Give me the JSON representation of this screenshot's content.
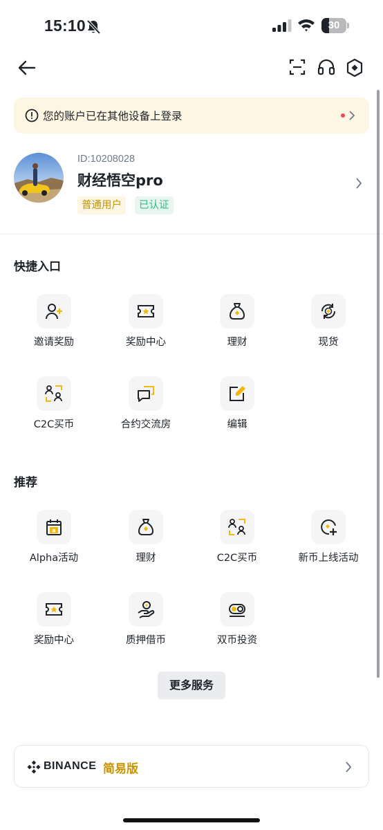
{
  "status_bar": {
    "time": "15:10",
    "battery_percent": 30,
    "icons": [
      "bell-slash-icon",
      "cellular-signal-icon",
      "wifi-icon",
      "battery-icon"
    ]
  },
  "nav": {
    "icons": [
      "back-arrow-icon",
      "scan-icon",
      "headset-icon",
      "settings-icon"
    ]
  },
  "alert": {
    "text": "您的账户已在其他设备上登录",
    "has_unread_dot": true,
    "icon": "info-circle-icon"
  },
  "profile": {
    "uid": "ID:10208028",
    "name": "财经悟空pro",
    "level": "普通用户",
    "verification": "已认证"
  },
  "shortcuts": {
    "title": "快捷入口",
    "items": [
      {
        "label": "邀请奖励",
        "icon": "invite-user-icon"
      },
      {
        "label": "奖励中心",
        "icon": "ticket-star-icon"
      },
      {
        "label": "理财",
        "icon": "money-bag-icon"
      },
      {
        "label": "现货",
        "icon": "spot-exchange-icon"
      },
      {
        "label": "C2C买币",
        "icon": "c2c-people-icon"
      },
      {
        "label": "合约交流房",
        "icon": "chat-room-icon"
      },
      {
        "label": "编辑",
        "icon": "edit-icon"
      }
    ]
  },
  "recommended": {
    "title": "推荐",
    "items": [
      {
        "label": "Alpha活动",
        "icon": "alpha-calendar-icon"
      },
      {
        "label": "理财",
        "icon": "money-bag-icon"
      },
      {
        "label": "C2C买币",
        "icon": "c2c-people-icon"
      },
      {
        "label": "新币上线活动",
        "icon": "new-coin-icon"
      },
      {
        "label": "奖励中心",
        "icon": "ticket-star-icon"
      },
      {
        "label": "质押借币",
        "icon": "loan-hand-icon"
      },
      {
        "label": "双币投资",
        "icon": "dual-coin-icon"
      }
    ]
  },
  "more_button": "更多服务",
  "lite": {
    "brand": "BINANCE",
    "label": "简易版"
  },
  "colors": {
    "accent": "#F0B90B",
    "accent_text": "#C99400",
    "success": "#2EBD85",
    "alert_bg": "#FDF6E3",
    "text": "#1E2329"
  }
}
